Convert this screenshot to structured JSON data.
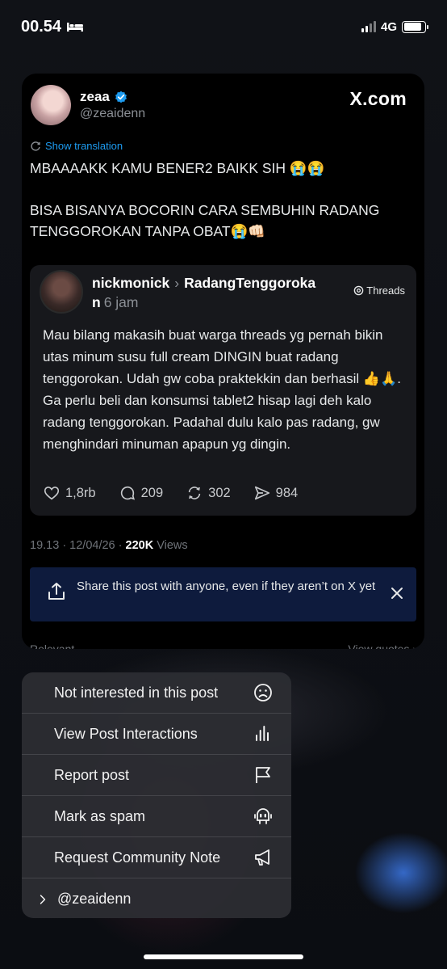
{
  "status_bar": {
    "time": "00.54",
    "network": "4G",
    "battery_fraction": 0.85
  },
  "post": {
    "author_name": "zeaa",
    "author_handle": "@zeaidenn",
    "brand": "X.com",
    "translate_label": "Show translation",
    "text": "MBAAAAKK KAMU BENER2 BAIKK SIH 😭😭\n\nBISA BISANYA BOCORIN CARA SEMBUHIN RADANG TENGGOROKAN TANPA OBAT😭👊🏻",
    "quote": {
      "author": "nickmonick",
      "topic": "RadangTenggoroka",
      "topic_wrap": "n",
      "time": "6 jam",
      "source": "Threads",
      "body": "Mau bilang makasih buat warga threads yg pernah bikin utas minum susu full cream DINGIN buat radang tenggorokan. Udah gw coba praktekkin dan berhasil 👍🙏. Ga perlu beli dan konsumsi tablet2 hisap lagi deh kalo radang tenggorokan. Padahal dulu kalo pas radang, gw menghindari minuman apapun yg dingin.",
      "likes": "1,8rb",
      "replies": "209",
      "reposts": "302",
      "shares": "984"
    },
    "timestamp": "19.13 · 12/04/26 · ",
    "views_count": "220K",
    "views_label": " Views",
    "share_banner_text": "Share this post with anyone, even if they aren’t on X yet",
    "peek_left": "Relevant ⌄",
    "peek_right": "View quotes ›"
  },
  "menu": {
    "items": [
      {
        "label": "Not interested in this post",
        "icon": "frown-face-icon"
      },
      {
        "label": "View Post Interactions",
        "icon": "bar-chart-icon"
      },
      {
        "label": "Report post",
        "icon": "flag-icon"
      },
      {
        "label": "Mark as spam",
        "icon": "robot-icon"
      },
      {
        "label": "Request Community Note",
        "icon": "megaphone-icon"
      }
    ],
    "account": "@zeaidenn"
  }
}
